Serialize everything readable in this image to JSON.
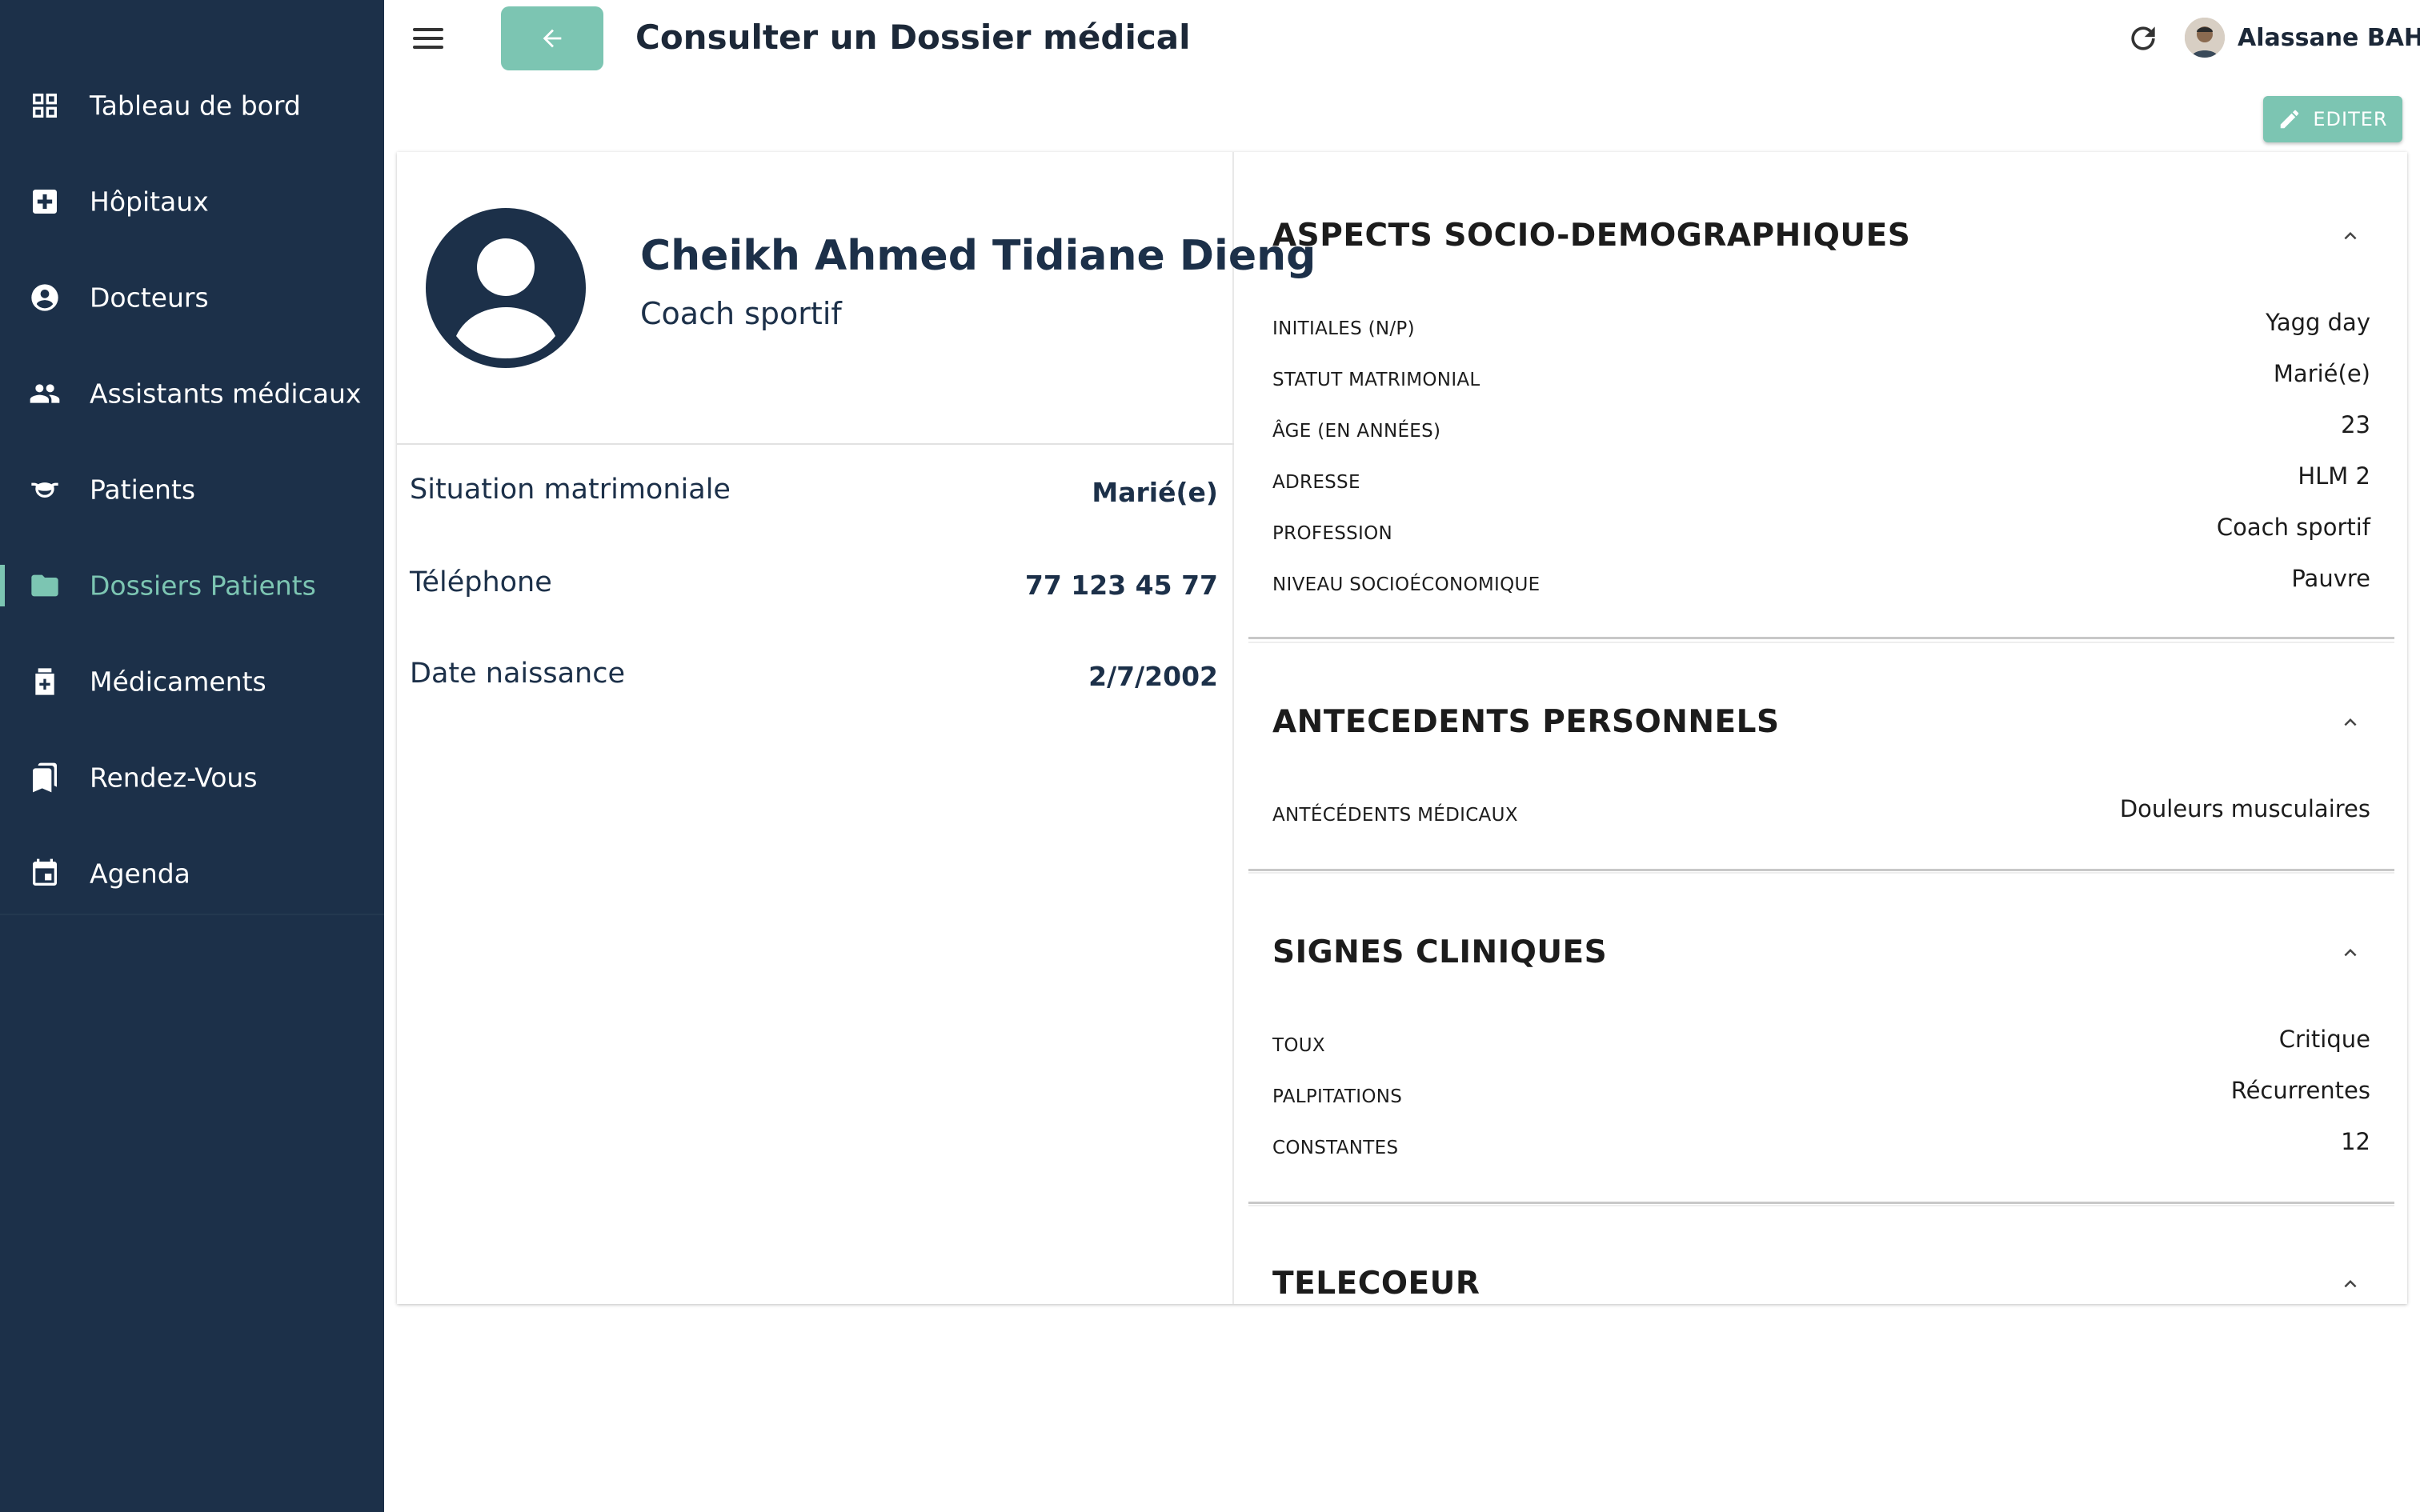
{
  "sidebar": {
    "items": [
      {
        "label": "Tableau de bord",
        "icon": "dashboard-icon"
      },
      {
        "label": "Hôpitaux",
        "icon": "hospital-icon"
      },
      {
        "label": "Docteurs",
        "icon": "doctor-icon"
      },
      {
        "label": "Assistants médicaux",
        "icon": "assistants-icon"
      },
      {
        "label": "Patients",
        "icon": "patient-mask-icon"
      },
      {
        "label": "Dossiers Patients",
        "icon": "folder-icon",
        "active": true
      },
      {
        "label": "Médicaments",
        "icon": "medication-icon"
      },
      {
        "label": "Rendez-Vous",
        "icon": "bookmarks-icon"
      },
      {
        "label": "Agenda",
        "icon": "calendar-icon"
      }
    ]
  },
  "header": {
    "title": "Consulter un Dossier médical",
    "user_name": "Alassane BAH"
  },
  "toolbar": {
    "edit_label": "EDITER"
  },
  "patient": {
    "name": "Cheikh Ahmed Tidiane Dieng",
    "job": "Coach sportif",
    "info": [
      {
        "label": "Situation matrimoniale",
        "value": "Marié(e)"
      },
      {
        "label": "Téléphone",
        "value": "77 123 45 77"
      },
      {
        "label": "Date naissance",
        "value": "2/7/2002"
      }
    ]
  },
  "sections": [
    {
      "title": "ASPECTS SOCIO-DEMOGRAPHIQUES",
      "fields": [
        {
          "label": "INITIALES (N/P)",
          "value": "Yagg day"
        },
        {
          "label": "STATUT MATRIMONIAL",
          "value": "Marié(e)"
        },
        {
          "label": "ÂGE (EN ANNÉES)",
          "value": "23"
        },
        {
          "label": "ADRESSE",
          "value": "HLM 2"
        },
        {
          "label": "PROFESSION",
          "value": "Coach sportif"
        },
        {
          "label": "NIVEAU SOCIOÉCONOMIQUE",
          "value": "Pauvre"
        }
      ]
    },
    {
      "title": "ANTECEDENTS PERSONNELS",
      "fields": [
        {
          "label": "ANTÉCÉDENTS MÉDICAUX",
          "value": "Douleurs musculaires"
        }
      ]
    },
    {
      "title": "SIGNES CLINIQUES",
      "fields": [
        {
          "label": "TOUX",
          "value": "Critique"
        },
        {
          "label": "PALPITATIONS",
          "value": "Récurrentes"
        },
        {
          "label": "CONSTANTES",
          "value": "12"
        }
      ]
    },
    {
      "title": "TELECOEUR",
      "fields": []
    }
  ],
  "colors": {
    "sidebar_bg": "#1c3049",
    "accent": "#7cc5b2"
  }
}
